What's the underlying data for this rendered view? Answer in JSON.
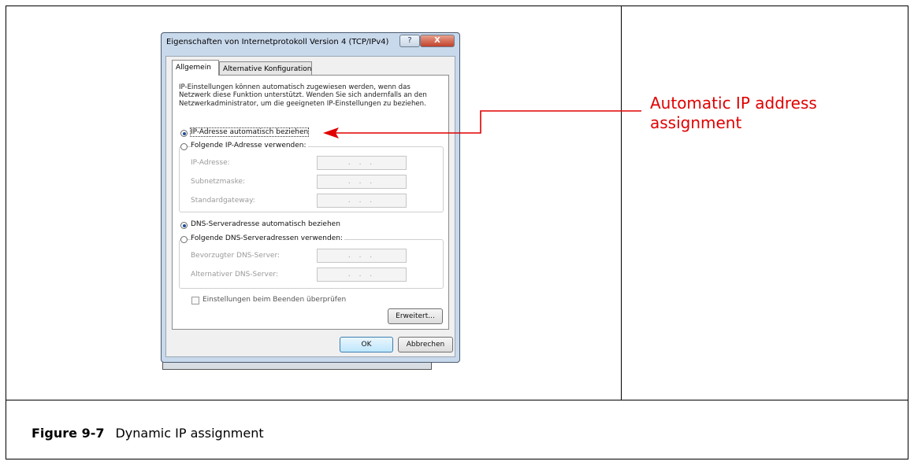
{
  "dialog": {
    "title": "Eigenschaften von Internetprotokoll Version 4 (TCP/IPv4)",
    "help_glyph": "?",
    "close_glyph": "X",
    "tabs": [
      "Allgemein",
      "Alternative Konfiguration"
    ],
    "description": "IP-Einstellungen können automatisch zugewiesen werden, wenn das Netzwerk diese Funktion unterstützt. Wenden Sie sich andernfalls an den Netzwerkadministrator, um die geeigneten IP-Einstellungen zu beziehen.",
    "ip_auto_label": "IP-Adresse automatisch beziehen",
    "ip_manual_label": "Folgende IP-Adresse verwenden:",
    "ip_fields": [
      {
        "label": "IP-Adresse:",
        "value": ". . ."
      },
      {
        "label": "Subnetzmaske:",
        "value": ". . ."
      },
      {
        "label": "Standardgateway:",
        "value": ". . ."
      }
    ],
    "dns_auto_label": "DNS-Serveradresse automatisch beziehen",
    "dns_manual_label": "Folgende DNS-Serveradressen verwenden:",
    "dns_fields": [
      {
        "label": "Bevorzugter DNS-Server:",
        "value": ". . ."
      },
      {
        "label": "Alternativer DNS-Server:",
        "value": ". . ."
      }
    ],
    "validate_label": "Einstellungen beim Beenden überprüfen",
    "advanced_button": "Erweitert...",
    "ok_button": "OK",
    "cancel_button": "Abbrechen"
  },
  "annotation": "Automatic IP address assignment",
  "caption": {
    "number": "Figure 9-7",
    "text": "Dynamic IP assignment"
  },
  "colors": {
    "annotation": "#e00000",
    "dialog_frame": "#c9d9ec",
    "default_button": "#bee6fd"
  }
}
